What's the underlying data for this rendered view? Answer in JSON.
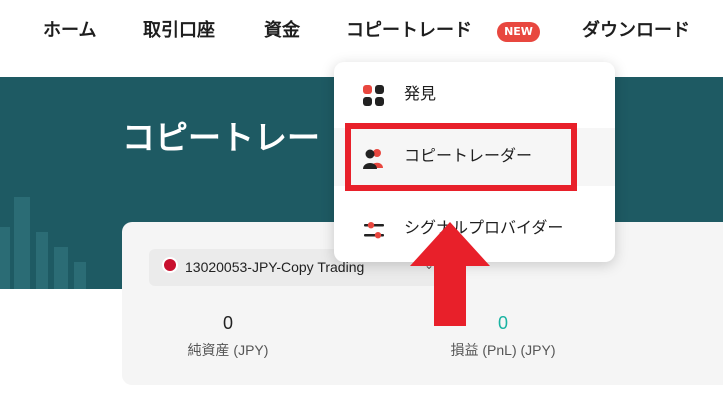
{
  "nav": {
    "home": "ホーム",
    "account": "取引口座",
    "funds": "資金",
    "copy_trade": "コピートレード",
    "new_badge": "NEW",
    "download": "ダウンロード"
  },
  "hero": {
    "title": "コピートレー"
  },
  "dropdown": {
    "items": [
      {
        "label": "発見",
        "icon": "grid-apps-icon"
      },
      {
        "label": "コピートレーダー",
        "icon": "users-icon"
      },
      {
        "label": "シグナルプロバイダー",
        "icon": "sliders-icon"
      }
    ]
  },
  "account": {
    "selected": "13020053-JPY-Copy Trading",
    "stats": [
      {
        "value": "0",
        "label": "純資産 (JPY)"
      },
      {
        "value": "0",
        "label": "損益 (PnL) (JPY)"
      }
    ]
  },
  "colors": {
    "hero_bg": "#1e5a63",
    "badge": "#e8473f",
    "highlight": "#e8202a",
    "pnl_value": "#19b3a2"
  }
}
